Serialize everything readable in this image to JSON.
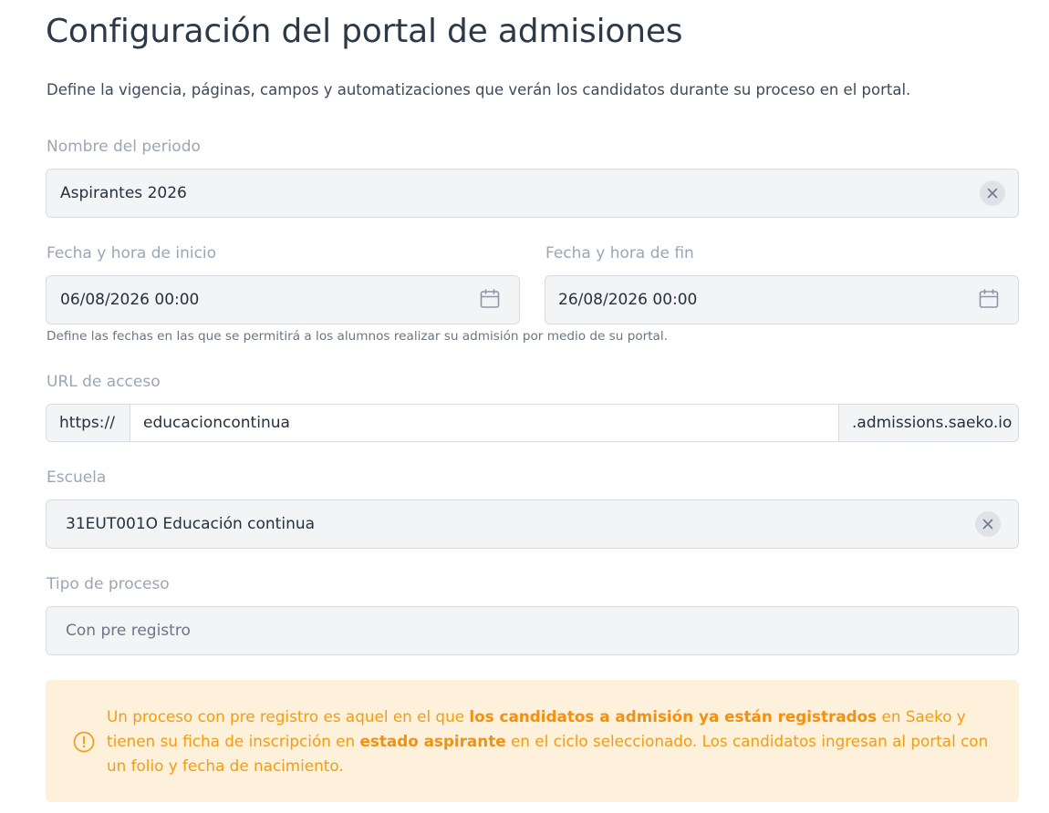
{
  "header": {
    "title": "Configuración del portal de admisiones",
    "description": "Define la vigencia, páginas, campos y automatizaciones que verán los candidatos durante su proceso en el portal."
  },
  "period_name": {
    "label": "Nombre del periodo",
    "value": "Aspirantes 2026"
  },
  "dates": {
    "start_label": "Fecha y hora de inicio",
    "start_value": "06/08/2026 00:00",
    "end_label": "Fecha y hora de fin",
    "end_value": "26/08/2026 00:00",
    "hint": "Define las fechas en las que se permitirá a los alumnos realizar su admisión por medio de su portal."
  },
  "url": {
    "label": "URL de acceso",
    "prefix": "https://",
    "value": "educacioncontinua",
    "suffix": ".admissions.saeko.io"
  },
  "school": {
    "label": "Escuela",
    "value": "31EUT001O Educación continua"
  },
  "process_type": {
    "label": "Tipo de proceso",
    "value": "Con pre registro"
  },
  "alert": {
    "text_1": "Un proceso con pre registro es aquel en el que ",
    "bold_1": "los candidatos a admisión ya están registrados",
    "text_2": " en Saeko y tienen su ficha de inscripción en ",
    "bold_2": "estado aspirante",
    "text_3": " en el ciclo seleccionado. Los candidatos ingresan al portal con un folio y fecha de nacimiento."
  },
  "colors": {
    "alert_background": "#fdf1dc",
    "alert_text": "#f39c12",
    "field_background": "#f2f4f6",
    "label": "#9aa6b6"
  }
}
